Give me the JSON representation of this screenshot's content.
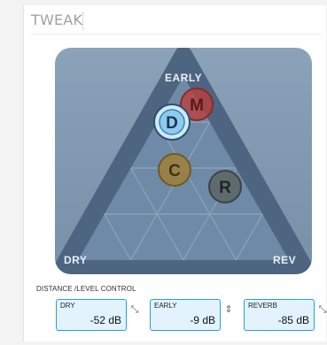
{
  "panel": {
    "title": "TWEAK"
  },
  "pad": {
    "corner_labels": {
      "early": "EARLY",
      "dry": "DRY",
      "rev": "REV"
    },
    "markers": [
      {
        "id": "m",
        "letter": "M",
        "color": "#b9403d",
        "selected": false
      },
      {
        "id": "d",
        "letter": "D",
        "color": "#a9d8f2",
        "selected": true
      },
      {
        "id": "c",
        "letter": "C",
        "color": "#9c803e",
        "selected": false
      },
      {
        "id": "r",
        "letter": "R",
        "color": "#5e6a6c",
        "selected": false
      }
    ],
    "colors": {
      "background": "#8199b0",
      "triangle": "#6e8aa6",
      "frame": "#4d6580",
      "grid": "#91a9c0"
    }
  },
  "distance_control": {
    "label": "DISTANCE /LEVEL CONTROL",
    "readouts": [
      {
        "id": "dry",
        "label": "DRY",
        "value": "-52 dB",
        "link_icon": "diagonal-resize-icon"
      },
      {
        "id": "early",
        "label": "EARLY",
        "value": "-9 dB",
        "link_icon": "vertical-resize-icon"
      },
      {
        "id": "reverb",
        "label": "REVERB",
        "value": "-85 dB",
        "link_icon": "corner-resize-icon"
      }
    ],
    "accent_color": "#2a9ee0"
  }
}
